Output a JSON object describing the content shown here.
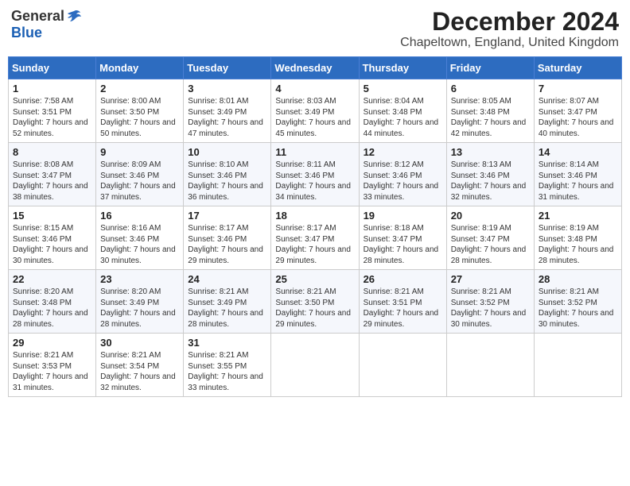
{
  "logo": {
    "general": "General",
    "blue": "Blue"
  },
  "title": "December 2024",
  "subtitle": "Chapeltown, England, United Kingdom",
  "days": [
    "Sunday",
    "Monday",
    "Tuesday",
    "Wednesday",
    "Thursday",
    "Friday",
    "Saturday"
  ],
  "weeks": [
    [
      {
        "day": 1,
        "sunrise": "7:58 AM",
        "sunset": "3:51 PM",
        "daylight": "7 hours and 52 minutes."
      },
      {
        "day": 2,
        "sunrise": "8:00 AM",
        "sunset": "3:50 PM",
        "daylight": "7 hours and 50 minutes."
      },
      {
        "day": 3,
        "sunrise": "8:01 AM",
        "sunset": "3:49 PM",
        "daylight": "7 hours and 47 minutes."
      },
      {
        "day": 4,
        "sunrise": "8:03 AM",
        "sunset": "3:49 PM",
        "daylight": "7 hours and 45 minutes."
      },
      {
        "day": 5,
        "sunrise": "8:04 AM",
        "sunset": "3:48 PM",
        "daylight": "7 hours and 44 minutes."
      },
      {
        "day": 6,
        "sunrise": "8:05 AM",
        "sunset": "3:48 PM",
        "daylight": "7 hours and 42 minutes."
      },
      {
        "day": 7,
        "sunrise": "8:07 AM",
        "sunset": "3:47 PM",
        "daylight": "7 hours and 40 minutes."
      }
    ],
    [
      {
        "day": 8,
        "sunrise": "8:08 AM",
        "sunset": "3:47 PM",
        "daylight": "7 hours and 38 minutes."
      },
      {
        "day": 9,
        "sunrise": "8:09 AM",
        "sunset": "3:46 PM",
        "daylight": "7 hours and 37 minutes."
      },
      {
        "day": 10,
        "sunrise": "8:10 AM",
        "sunset": "3:46 PM",
        "daylight": "7 hours and 36 minutes."
      },
      {
        "day": 11,
        "sunrise": "8:11 AM",
        "sunset": "3:46 PM",
        "daylight": "7 hours and 34 minutes."
      },
      {
        "day": 12,
        "sunrise": "8:12 AM",
        "sunset": "3:46 PM",
        "daylight": "7 hours and 33 minutes."
      },
      {
        "day": 13,
        "sunrise": "8:13 AM",
        "sunset": "3:46 PM",
        "daylight": "7 hours and 32 minutes."
      },
      {
        "day": 14,
        "sunrise": "8:14 AM",
        "sunset": "3:46 PM",
        "daylight": "7 hours and 31 minutes."
      }
    ],
    [
      {
        "day": 15,
        "sunrise": "8:15 AM",
        "sunset": "3:46 PM",
        "daylight": "7 hours and 30 minutes."
      },
      {
        "day": 16,
        "sunrise": "8:16 AM",
        "sunset": "3:46 PM",
        "daylight": "7 hours and 30 minutes."
      },
      {
        "day": 17,
        "sunrise": "8:17 AM",
        "sunset": "3:46 PM",
        "daylight": "7 hours and 29 minutes."
      },
      {
        "day": 18,
        "sunrise": "8:17 AM",
        "sunset": "3:47 PM",
        "daylight": "7 hours and 29 minutes."
      },
      {
        "day": 19,
        "sunrise": "8:18 AM",
        "sunset": "3:47 PM",
        "daylight": "7 hours and 28 minutes."
      },
      {
        "day": 20,
        "sunrise": "8:19 AM",
        "sunset": "3:47 PM",
        "daylight": "7 hours and 28 minutes."
      },
      {
        "day": 21,
        "sunrise": "8:19 AM",
        "sunset": "3:48 PM",
        "daylight": "7 hours and 28 minutes."
      }
    ],
    [
      {
        "day": 22,
        "sunrise": "8:20 AM",
        "sunset": "3:48 PM",
        "daylight": "7 hours and 28 minutes."
      },
      {
        "day": 23,
        "sunrise": "8:20 AM",
        "sunset": "3:49 PM",
        "daylight": "7 hours and 28 minutes."
      },
      {
        "day": 24,
        "sunrise": "8:21 AM",
        "sunset": "3:49 PM",
        "daylight": "7 hours and 28 minutes."
      },
      {
        "day": 25,
        "sunrise": "8:21 AM",
        "sunset": "3:50 PM",
        "daylight": "7 hours and 29 minutes."
      },
      {
        "day": 26,
        "sunrise": "8:21 AM",
        "sunset": "3:51 PM",
        "daylight": "7 hours and 29 minutes."
      },
      {
        "day": 27,
        "sunrise": "8:21 AM",
        "sunset": "3:52 PM",
        "daylight": "7 hours and 30 minutes."
      },
      {
        "day": 28,
        "sunrise": "8:21 AM",
        "sunset": "3:52 PM",
        "daylight": "7 hours and 30 minutes."
      }
    ],
    [
      {
        "day": 29,
        "sunrise": "8:21 AM",
        "sunset": "3:53 PM",
        "daylight": "7 hours and 31 minutes."
      },
      {
        "day": 30,
        "sunrise": "8:21 AM",
        "sunset": "3:54 PM",
        "daylight": "7 hours and 32 minutes."
      },
      {
        "day": 31,
        "sunrise": "8:21 AM",
        "sunset": "3:55 PM",
        "daylight": "7 hours and 33 minutes."
      },
      null,
      null,
      null,
      null
    ]
  ],
  "labels": {
    "sunrise": "Sunrise:",
    "sunset": "Sunset:",
    "daylight": "Daylight hours"
  }
}
